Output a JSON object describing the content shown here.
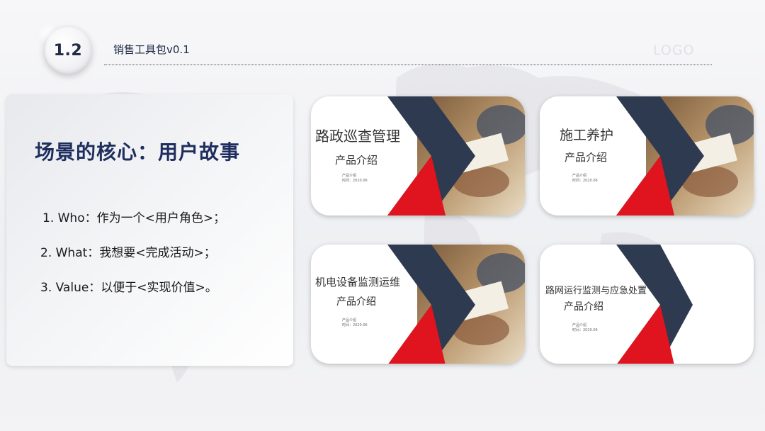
{
  "header": {
    "section_number": "1.2",
    "title": "销售工具包v0.1",
    "logo": "LOGO"
  },
  "panel": {
    "heading": "场景的核心：用户故事",
    "items": [
      "1.  Who：作为一个<用户角色>；",
      "2. What：我想要<完成活动>；",
      "3. Value：以便于<实现价值>。"
    ]
  },
  "cards": [
    {
      "title": "路政巡查管理",
      "subtitle": "产品介绍",
      "meta_line1": "产品介绍",
      "meta_line2": "时间：2020.06"
    },
    {
      "title": "施工养护",
      "subtitle": "产品介绍",
      "meta_line1": "产品介绍",
      "meta_line2": "时间：2020.06"
    },
    {
      "title": "机电设备监测运维",
      "subtitle": "产品介绍",
      "meta_line1": "产品介绍",
      "meta_line2": "时间：2020.06"
    },
    {
      "title": "路网运行监测与应急处置",
      "subtitle": "产品介绍",
      "meta_line1": "产品介绍",
      "meta_line2": "时间：2020.06"
    }
  ],
  "colors": {
    "navy": "#2e3a4f",
    "red": "#e0141e",
    "heading": "#1f2e5e"
  }
}
